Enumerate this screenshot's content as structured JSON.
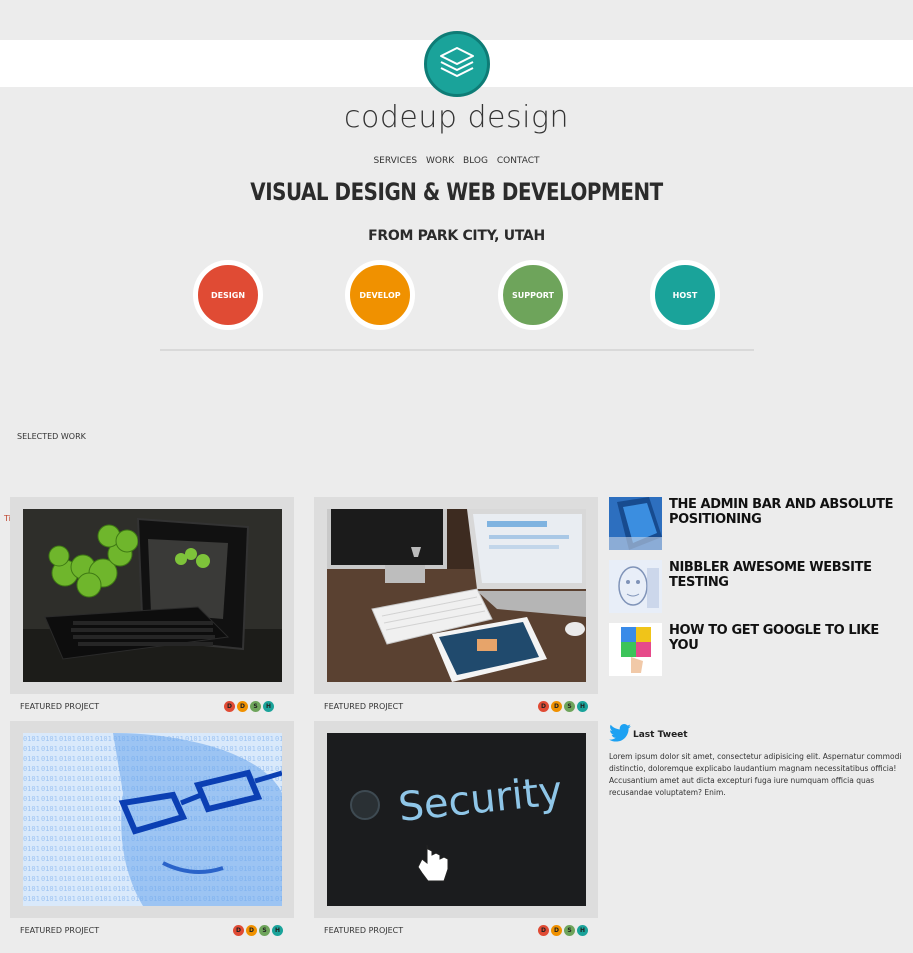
{
  "brand": {
    "name": "codeup design",
    "logo_icon": "layers-icon"
  },
  "nav": {
    "items": [
      "SERVICES",
      "WORK",
      "BLOG",
      "CONTACT"
    ]
  },
  "hero": {
    "headline": "VISUAL DESIGN & WEB DEVELOPMENT",
    "subhead": "FROM PARK CITY, UTAH"
  },
  "services": [
    {
      "label": "DESIGN",
      "color": "#e04b34"
    },
    {
      "label": "DEVELOP",
      "color": "#f09100"
    },
    {
      "label": "SUPPORT",
      "color": "#6ea45b"
    },
    {
      "label": "HOST",
      "color": "#1aa39a"
    }
  ],
  "work": {
    "section_label": "SELECTED WORK",
    "edge_glyph": "Ti",
    "projects": [
      {
        "caption": "FEATURED PROJECT",
        "image": "tablet-apples-image"
      },
      {
        "caption": "FEATURED PROJECT",
        "image": "imac-macbook-ipad-image"
      },
      {
        "caption": "FEATURED PROJECT",
        "image": "binary-face-glasses-image"
      },
      {
        "caption": "FEATURED PROJECT",
        "image": "security-keyboard-image"
      }
    ],
    "tags": [
      {
        "letter": "D",
        "color": "#e04b34"
      },
      {
        "letter": "D",
        "color": "#f09100"
      },
      {
        "letter": "S",
        "color": "#6ea45b"
      },
      {
        "letter": "H",
        "color": "#1aa39a"
      }
    ]
  },
  "blog": {
    "posts": [
      {
        "title": "THE ADMIN BAR AND ABSOLUTE POSITIONING",
        "thumb": "phone-thumb"
      },
      {
        "title": "NIBBLER AWESOME WEBSITE TESTING",
        "thumb": "face-sketch-thumb"
      },
      {
        "title": "HOW TO GET GOOGLE TO LIKE YOU",
        "thumb": "colorful-hand-thumb"
      }
    ]
  },
  "tweet": {
    "heading": "Last Tweet",
    "icon": "twitter-bird-icon",
    "body": "Lorem ipsum dolor sit amet, consectetur adipisicing elit. Aspernatur commodi distinctio, doloremque explicabo laudantium magnam necessitatibus officia! Accusantium amet aut dicta excepturi fuga iure numquam officia quas recusandae voluptatem? Enim."
  }
}
